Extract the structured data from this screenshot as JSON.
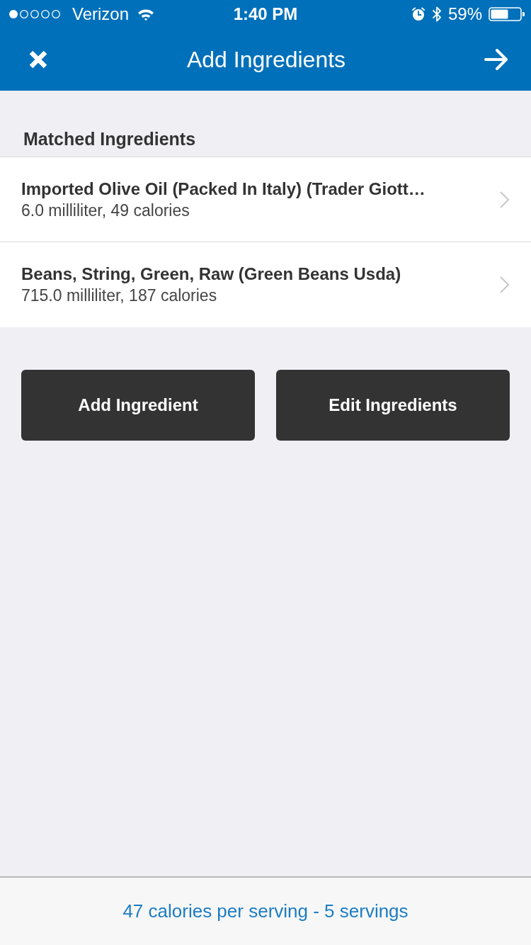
{
  "status_bar": {
    "carrier": "Verizon",
    "time": "1:40 PM",
    "battery": "59%"
  },
  "nav_bar": {
    "title": "Add Ingredients"
  },
  "section": {
    "title": "Matched Ingredients"
  },
  "ingredients": [
    {
      "name": "Imported Olive Oil (Packed In Italy) (Trader Giott…",
      "detail": "6.0 milliliter, 49 calories"
    },
    {
      "name": "Beans, String, Green, Raw (Green Beans Usda)",
      "detail": "715.0 milliliter, 187 calories"
    }
  ],
  "buttons": [
    "Add Ingredient",
    "Edit Ingredients"
  ],
  "footer": {
    "summary": "47 calories per serving - 5 servings"
  }
}
